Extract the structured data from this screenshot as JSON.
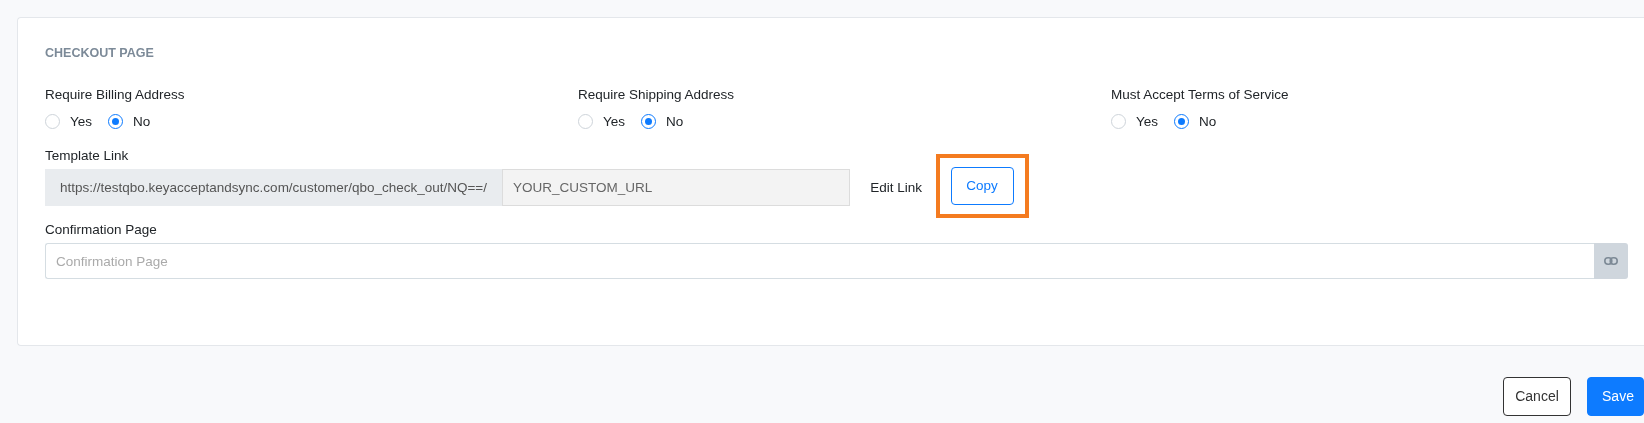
{
  "section_title": "CHECKOUT PAGE",
  "radio_groups": [
    {
      "label": "Require Billing Address",
      "options": [
        {
          "label": "Yes",
          "selected": false
        },
        {
          "label": "No",
          "selected": true
        }
      ]
    },
    {
      "label": "Require Shipping Address",
      "options": [
        {
          "label": "Yes",
          "selected": false
        },
        {
          "label": "No",
          "selected": true
        }
      ]
    },
    {
      "label": "Must Accept Terms of Service",
      "options": [
        {
          "label": "Yes",
          "selected": false
        },
        {
          "label": "No",
          "selected": true
        }
      ]
    }
  ],
  "template_link": {
    "label": "Template Link",
    "prefix": "https://testqbo.keyacceptandsync.com/customer/qbo_check_out/NQ==/",
    "placeholder": "YOUR_CUSTOM_URL",
    "edit_link": "Edit Link",
    "copy_button": {
      "label": "Copy",
      "highlighted": true
    }
  },
  "confirmation": {
    "label": "Confirmation Page",
    "placeholder": "Confirmation Page"
  },
  "buttons": [
    {
      "label": "Cancel",
      "kind": "secondary"
    },
    {
      "label": "Save",
      "kind": "primary"
    }
  ]
}
